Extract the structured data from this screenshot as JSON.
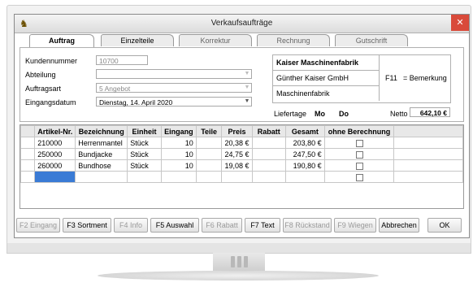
{
  "window": {
    "title": "Verkaufsaufträge",
    "close_label": "✕",
    "app_icon": "sheep-icon"
  },
  "tabs": [
    {
      "label": "Auftrag"
    },
    {
      "label": "Einzelteile"
    },
    {
      "label": "Korrektur"
    },
    {
      "label": "Rechnung"
    },
    {
      "label": "Gutschrift"
    }
  ],
  "form": {
    "kundennummer_label": "Kundennummer",
    "kundennummer_value": "10700",
    "abteilung_label": "Abteilung",
    "abteilung_value": "",
    "auftragsart_label": "Auftragsart",
    "auftragsart_value": "5  Angebot",
    "eingangsdatum_label": "Eingangsdatum",
    "eingangsdatum_value": "Dienstag, 14. April 2020"
  },
  "customer": {
    "name": "Kaiser Maschinenfabrik",
    "line2": "Günther Kaiser GmbH",
    "line3": "Maschinenfabrik",
    "f11_label": "F11",
    "bemerkung_label": "= Bemerkung",
    "liefertage_label": "Liefertage",
    "liefertage_values": "Mo  Do",
    "netto_label": "Netto",
    "netto_value": "642,10 €"
  },
  "table": {
    "headers": [
      "Artikel-Nr.",
      "Bezeichnung",
      "Einheit",
      "Eingang",
      "Teile",
      "Preis",
      "Rabatt",
      "Gesamt",
      "ohne Berechnung"
    ],
    "rows": [
      [
        "210000",
        "Herrenmantel",
        "Stück",
        "10",
        "",
        "20,38 €",
        "",
        "203,80 €",
        ""
      ],
      [
        "250000",
        "Bundjacke",
        "Stück",
        "10",
        "",
        "24,75 €",
        "",
        "247,50 €",
        ""
      ],
      [
        "260000",
        "Bundhose",
        "Stück",
        "10",
        "",
        "19,08 €",
        "",
        "190,80 €",
        ""
      ]
    ]
  },
  "buttons": [
    {
      "label": "F2 Eingang",
      "enabled": false
    },
    {
      "label": "F3 Sortment",
      "enabled": true
    },
    {
      "label": "F4 Info",
      "enabled": false
    },
    {
      "label": "F5 Auswahl",
      "enabled": true
    },
    {
      "label": "F6 Rabatt",
      "enabled": false
    },
    {
      "label": "F7 Text",
      "enabled": true
    },
    {
      "label": "F8 Rückstand",
      "enabled": false
    },
    {
      "label": "F9 Wiegen",
      "enabled": false
    },
    {
      "label": "Abbrechen",
      "enabled": true
    },
    {
      "label": "OK",
      "enabled": true
    }
  ]
}
